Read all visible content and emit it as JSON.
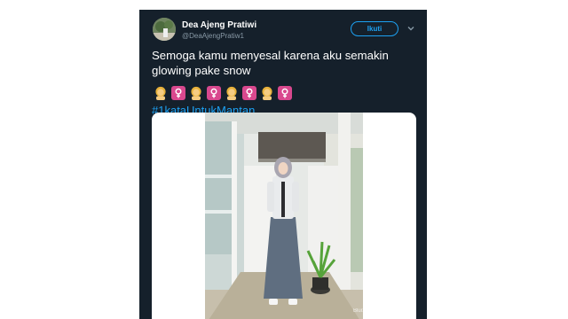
{
  "tweet": {
    "display_name": "Dea Ajeng Pratiwi",
    "handle": "@DeaAjengPratiw1",
    "follow_label": "Ikuti",
    "text": "Semoga kamu menyesal karena aku semakin glowing pake snow",
    "emojis": [
      "woman-emoji",
      "female-sign-emoji",
      "woman-emoji",
      "female-sign-emoji",
      "woman-emoji",
      "female-sign-emoji",
      "woman-emoji",
      "female-sign-emoji"
    ],
    "hashtag": "#1kataUntukMantan",
    "photo_watermark": "Blur/Photography"
  },
  "colors": {
    "card_background": "#15202b",
    "accent": "#1da1f2",
    "secondary_text": "#8899a6",
    "female_sign": "#d9488e"
  },
  "icons": {
    "more": "chevron-down-icon"
  }
}
